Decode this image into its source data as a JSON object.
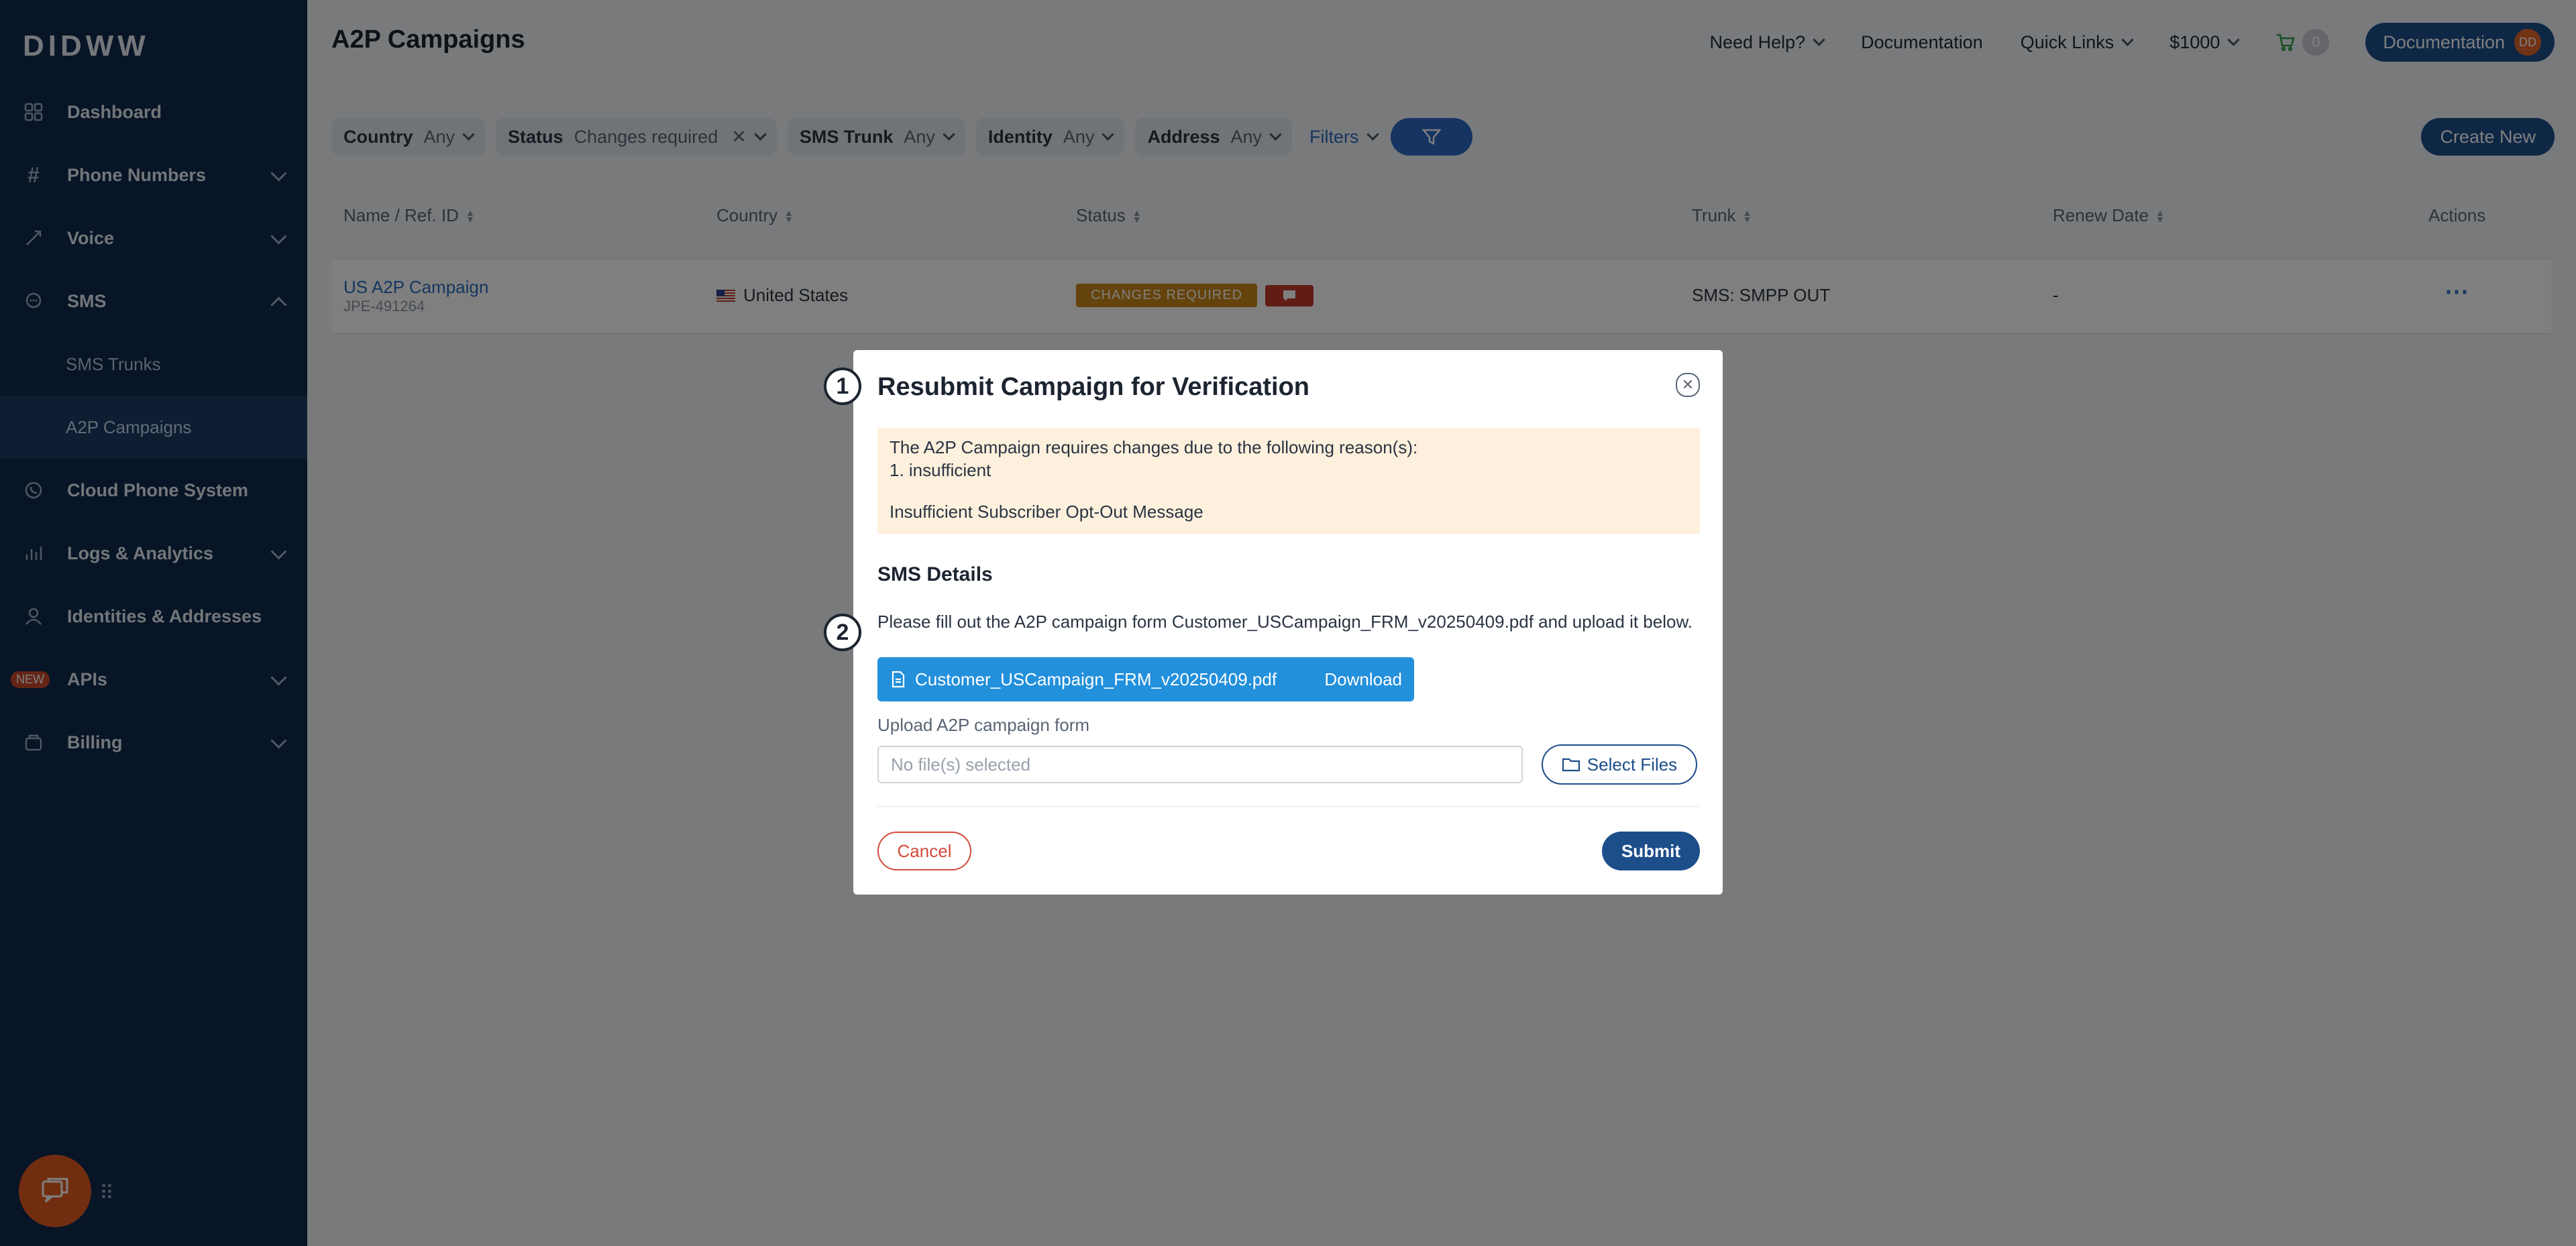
{
  "app": {
    "logo": "DIDWW"
  },
  "sidebar": {
    "items": [
      {
        "label": "Dashboard",
        "icon": "grid-icon"
      },
      {
        "label": "Phone Numbers",
        "icon": "hash-icon"
      },
      {
        "label": "Voice",
        "icon": "call-icon"
      },
      {
        "label": "SMS",
        "icon": "chat-icon"
      },
      {
        "label": "Cloud Phone System",
        "icon": "phone-circle-icon"
      },
      {
        "label": "Logs & Analytics",
        "icon": "bar-chart-icon"
      },
      {
        "label": "Identities & Addresses",
        "icon": "user-icon"
      },
      {
        "label": "APIs",
        "badge": "NEW"
      },
      {
        "label": "Billing",
        "icon": "wallet-icon"
      }
    ],
    "sms_sub": [
      "SMS Trunks",
      "A2P Campaigns"
    ]
  },
  "header": {
    "title": "A2P Campaigns",
    "need_help": "Need Help?",
    "documentation": "Documentation",
    "quick_links": "Quick Links",
    "balance": "$1000",
    "cart_count": "0",
    "account_pill": "Documentation",
    "avatar_initials": "DD"
  },
  "filters": {
    "country_label": "Country",
    "country_value": "Any",
    "status_label": "Status",
    "status_value": "Changes required",
    "trunk_label": "SMS Trunk",
    "trunk_value": "Any",
    "identity_label": "Identity",
    "identity_value": "Any",
    "address_label": "Address",
    "address_value": "Any",
    "filters_link": "Filters",
    "create_new": "Create New"
  },
  "table": {
    "columns": [
      "Name / Ref. ID",
      "Country",
      "Status",
      "Trunk",
      "Renew Date",
      "Actions"
    ],
    "row": {
      "name": "US A2P Campaign",
      "ref": "JPE-491264",
      "country": "United States",
      "status": "CHANGES REQUIRED",
      "trunk": "SMS: SMPP OUT",
      "renew": "-"
    }
  },
  "modal": {
    "title": "Resubmit Campaign for Verification",
    "warning_line1": "The A2P Campaign requires changes due to the following reason(s):",
    "warning_line2": "1. insufficient",
    "warning_line3": "Insufficient Subscriber Opt-Out Message",
    "section_title": "SMS Details",
    "instructions": "Please fill out the A2P campaign form Customer_USCampaign_FRM_v20250409.pdf and upload it below.",
    "file_name": "Customer_USCampaign_FRM_v20250409.pdf",
    "download": "Download",
    "upload_label": "Upload A2P campaign form",
    "file_placeholder": "No file(s) selected",
    "select_files": "Select Files",
    "cancel": "Cancel",
    "submit": "Submit"
  },
  "steps": [
    "1",
    "2"
  ],
  "colors": {
    "sidebar": "#0e2a4c",
    "primary": "#1c4e8a",
    "download_btn": "#2390db",
    "warning_bg": "#fdf0dc",
    "status_badge": "#c98718"
  }
}
